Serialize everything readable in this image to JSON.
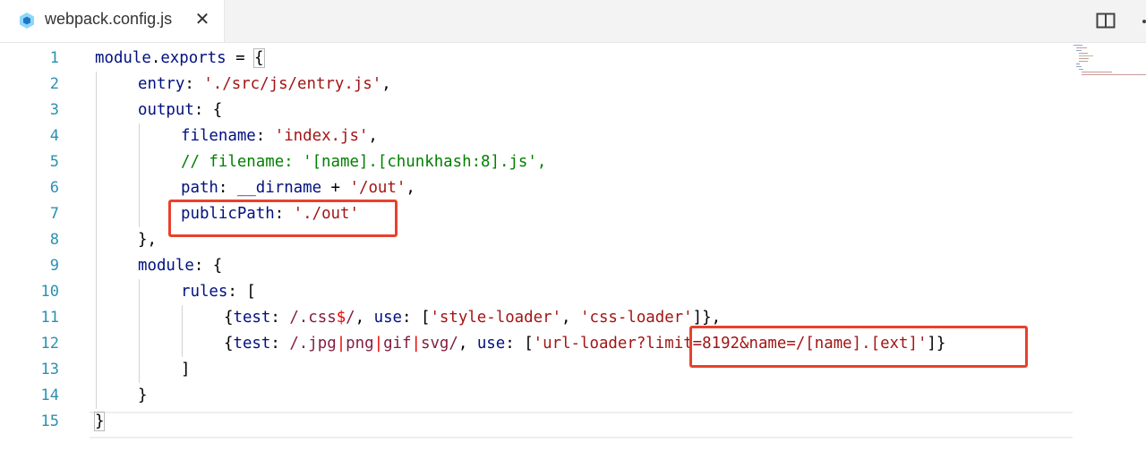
{
  "tab": {
    "filename": "webpack.config.js",
    "close_label": "✕",
    "icon": "webpack-file-icon"
  },
  "toolbar": {
    "split_icon": "split-editor-icon",
    "more_icon": "more-actions-icon"
  },
  "line_numbers": [
    "1",
    "2",
    "3",
    "4",
    "5",
    "6",
    "7",
    "8",
    "9",
    "10",
    "11",
    "12",
    "13",
    "14",
    "15"
  ],
  "code": {
    "l1": {
      "obj": "module",
      "dot": ".",
      "prop": "exports",
      "op": " = ",
      "brace": "{"
    },
    "l2": {
      "key": "entry",
      "colon": ": ",
      "val": "'./src/js/entry.js'",
      "end": ","
    },
    "l3": {
      "key": "output",
      "rest": ": {"
    },
    "l4": {
      "key": "filename",
      "colon": ": ",
      "val": "'index.js'",
      "end": ","
    },
    "l5": {
      "comment": "// filename: '[name].[chunkhash:8].js',"
    },
    "l6": {
      "key": "path",
      "colon": ": ",
      "var": "__dirname",
      "op": " + ",
      "val": "'/out'",
      "end": ","
    },
    "l7": {
      "key": "publicPath",
      "colon": ": ",
      "val": "'./out'"
    },
    "l8": {
      "text": "},"
    },
    "l9": {
      "key": "module",
      "rest": ": {"
    },
    "l10": {
      "key": "rules",
      "rest": ": ["
    },
    "l11": {
      "open": "{",
      "key1": "test",
      "colon1": ": ",
      "re1": "/.css",
      "re2": "$",
      "re3": "/",
      "sep": ", ",
      "key2": "use",
      "colon2": ": [",
      "s1": "'style-loader'",
      "comma": ", ",
      "s2": "'css-loader'",
      "close": "]},"
    },
    "l12": {
      "open": "{",
      "key1": "test",
      "colon1": ": ",
      "re1": "/.jpg",
      "p1": "|",
      "re2": "png",
      "p2": "|",
      "re3": "gif",
      "p3": "|",
      "re4": "svg/",
      "sep": ", ",
      "key2": "use",
      "colon2": ": [",
      "s1": "'url-loader?limit=8192&name=/[name].[ext]'",
      "close": "]}"
    },
    "l13": {
      "text": "]"
    },
    "l14": {
      "text": "}"
    },
    "l15": {
      "text": "}"
    }
  },
  "colors": {
    "line_number": "#2b91af",
    "property": "#001080",
    "string": "#a31515",
    "comment": "#008000",
    "regex": "#811f3f",
    "highlight_box": "#e8412c"
  }
}
